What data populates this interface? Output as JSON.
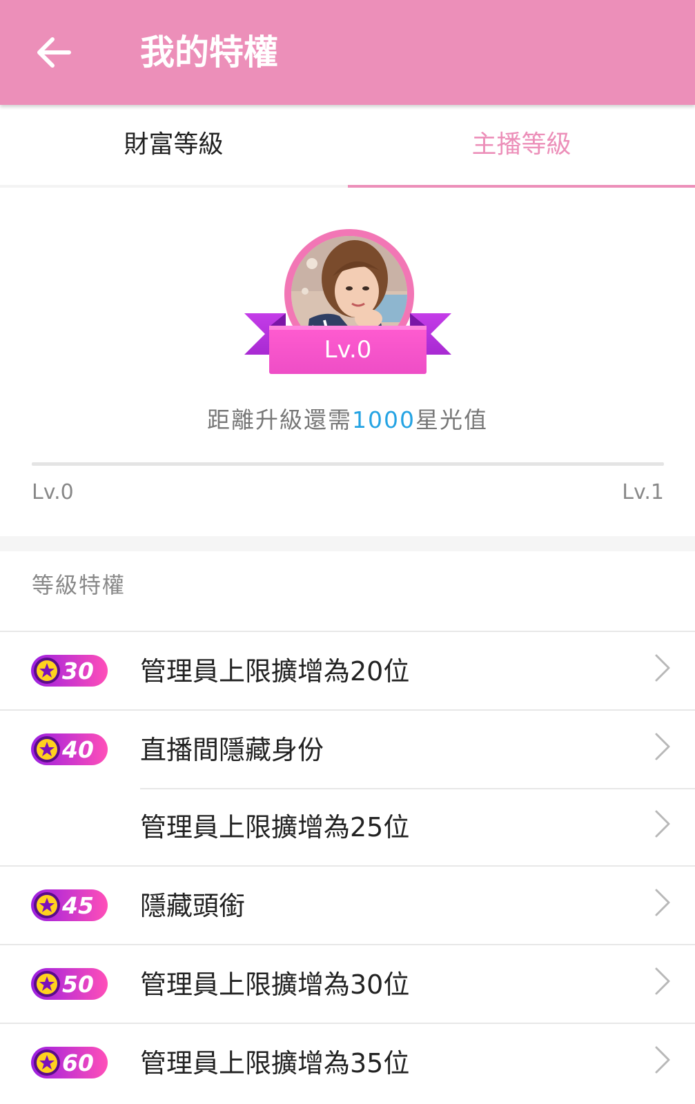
{
  "header": {
    "title": "我的特權"
  },
  "tabs": [
    {
      "label": "財富等級",
      "active": false
    },
    {
      "label": "主播等級",
      "active": true
    }
  ],
  "level": {
    "current_badge": "Lv.0",
    "upgrade_prefix": "距離升級還需",
    "upgrade_amount": "1000",
    "upgrade_suffix": "星光值",
    "progress": 0,
    "start_label": "Lv.0",
    "end_label": "Lv.1"
  },
  "privileges": {
    "header": "等級特權",
    "items": [
      {
        "level": "30",
        "text": "管理員上限擴增為20位",
        "show_badge": true
      },
      {
        "level": "40",
        "text": "直播間隱藏身份",
        "show_badge": true
      },
      {
        "level": "40",
        "text": "管理員上限擴增為25位",
        "show_badge": false
      },
      {
        "level": "45",
        "text": "隱藏頭銜",
        "show_badge": true
      },
      {
        "level": "50",
        "text": "管理員上限擴增為30位",
        "show_badge": true
      },
      {
        "level": "60",
        "text": "管理員上限擴增為35位",
        "show_badge": true
      }
    ]
  },
  "colors": {
    "accent": "#ec8fb9",
    "highlight": "#24a3e3",
    "badge_purple": "#9b1fe0",
    "badge_pink": "#ff4fb8",
    "star": "#ffd21e"
  },
  "icons": {
    "back": "arrow-left-icon",
    "chevron": "chevron-right-icon",
    "star": "star-icon"
  }
}
